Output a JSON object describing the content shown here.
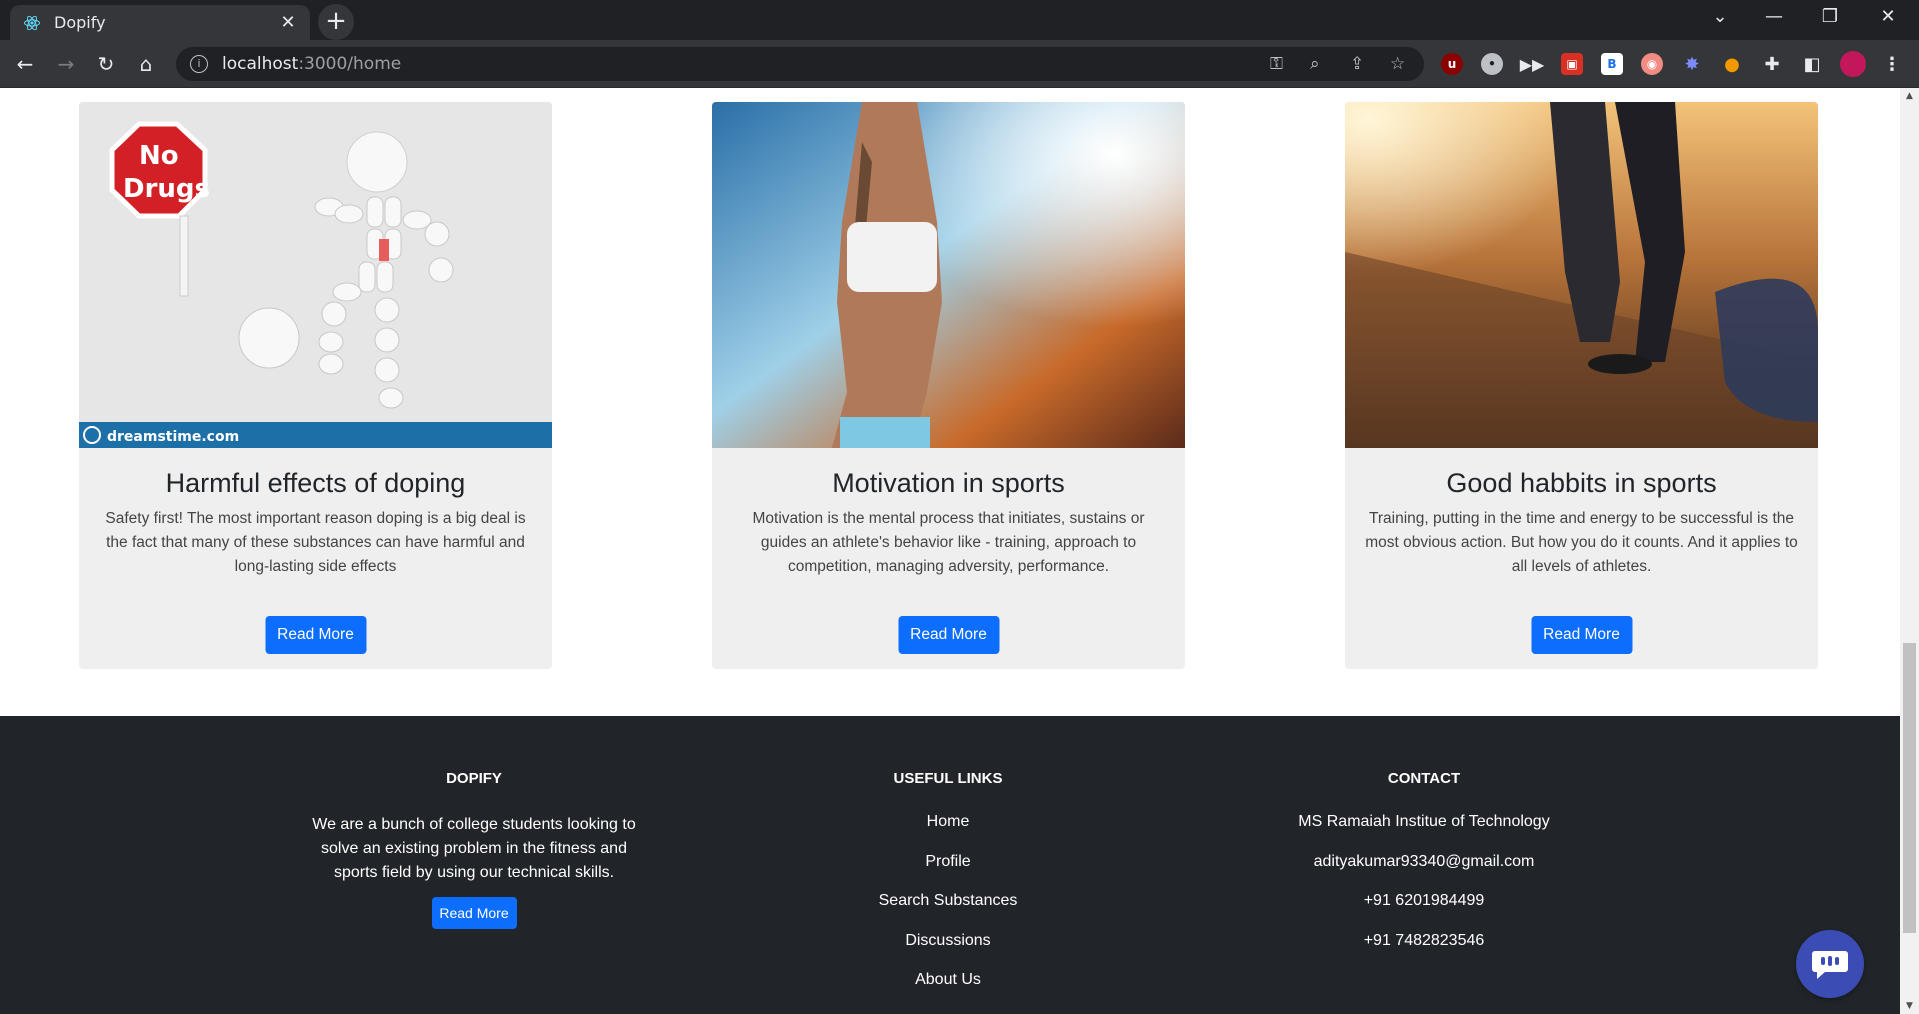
{
  "browser": {
    "tab_title": "Dopify",
    "tab_close": "✕",
    "new_tab": "+",
    "url_host": "localhost",
    "url_path": ":3000/home",
    "window_controls": [
      "⌄",
      "—",
      "❐",
      "✕"
    ]
  },
  "cards": [
    {
      "title": "Harmful effects of doping",
      "text": "Safety first! The most important reason doping is a big deal is the fact that many of these substances can have harmful and long-lasting side effects",
      "button": "Read More",
      "image": {
        "sign_line1": "No",
        "sign_line2": "Drugs",
        "watermark": "dreamstime.com"
      }
    },
    {
      "title": "Motivation in sports",
      "text": "Motivation is the mental process that initiates, sustains or guides an athlete's behavior like - training, approach to competition, managing adversity, performance.",
      "button": "Read More"
    },
    {
      "title": "Good habbits in sports",
      "text": "Training, putting in the time and energy to be successful is the most obvious action. But how you do it counts. And it applies to all levels of athletes.",
      "button": "Read More"
    }
  ],
  "footer": {
    "about": {
      "heading": "DOPIFY",
      "line1": "We are a bunch of college students looking to",
      "line2": "solve an existing problem in the fitness and",
      "line3": "sports field by using our technical skills.",
      "button": "Read More"
    },
    "links": {
      "heading": "USEFUL LINKS",
      "items": [
        "Home",
        "Profile",
        "Search Substances",
        "Discussions",
        "About Us"
      ]
    },
    "contact": {
      "heading": "CONTACT",
      "items": [
        "MS Ramaiah Institue of Technology",
        "adityakumar93340@gmail.com",
        "+91 6201984499",
        "+91 7482823546"
      ]
    }
  },
  "colors": {
    "primary": "#0d6efd",
    "footer_bg": "#212529",
    "card_bg": "#efefef",
    "chat_bg": "#3b4db4"
  }
}
